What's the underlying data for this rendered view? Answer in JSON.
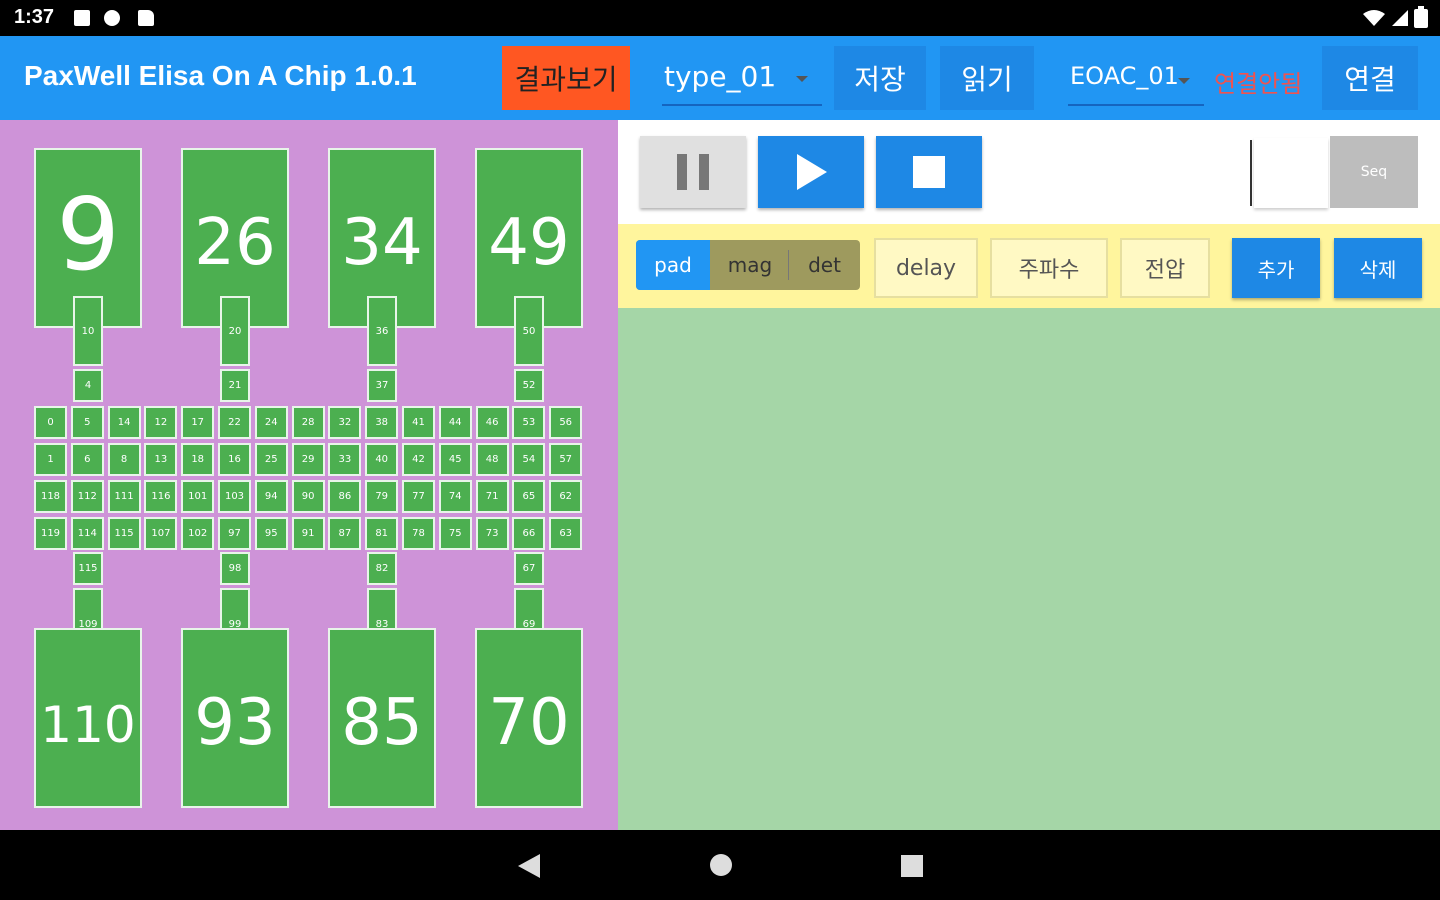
{
  "status_bar": {
    "time": "1:37"
  },
  "app_bar": {
    "title": "PaxWell Elisa On A Chip 1.0.1",
    "result_button": "결과보기",
    "type_dropdown": "type_01",
    "save_button": "저장",
    "read_button": "읽기",
    "device_dropdown": "EOAC_01",
    "connection_status": "연결안됨",
    "connect_button": "연결"
  },
  "chip": {
    "top_pads": [
      "9",
      "26",
      "34",
      "49"
    ],
    "bottom_pads": [
      "110",
      "93",
      "85",
      "70"
    ],
    "top_connectors": [
      [
        "10",
        "4"
      ],
      [
        "20",
        "21"
      ],
      [
        "36",
        "37"
      ],
      [
        "50",
        "52"
      ]
    ],
    "bottom_connectors": [
      [
        "115",
        "109"
      ],
      [
        "98",
        "99"
      ],
      [
        "82",
        "83"
      ],
      [
        "67",
        "69"
      ]
    ],
    "grid": [
      [
        "0",
        "5",
        "14",
        "12",
        "17",
        "22",
        "24",
        "28",
        "32",
        "38",
        "41",
        "44",
        "46",
        "53",
        "56"
      ],
      [
        "1",
        "6",
        "8",
        "13",
        "18",
        "16",
        "25",
        "29",
        "33",
        "40",
        "42",
        "45",
        "48",
        "54",
        "57"
      ],
      [
        "118",
        "112",
        "111",
        "116",
        "101",
        "103",
        "94",
        "90",
        "86",
        "79",
        "77",
        "74",
        "71",
        "65",
        "62"
      ],
      [
        "119",
        "114",
        "115",
        "107",
        "102",
        "97",
        "95",
        "91",
        "87",
        "81",
        "78",
        "75",
        "73",
        "66",
        "63"
      ]
    ]
  },
  "controls": {
    "seq_button": "Seq",
    "segment": [
      "pad",
      "mag",
      "det"
    ],
    "segment_active": "pad",
    "params": [
      "delay",
      "주파수",
      "전압"
    ],
    "add_button": "추가",
    "delete_button": "삭제"
  },
  "colors": {
    "app_bar": "#2196F3",
    "result_button": "#FF5722",
    "chip_panel": "#CE93D8",
    "pad": "#4CAF50",
    "content_area": "#A5D6A7",
    "param_bar": "#FFF59D",
    "status_error": "#EF5350"
  }
}
